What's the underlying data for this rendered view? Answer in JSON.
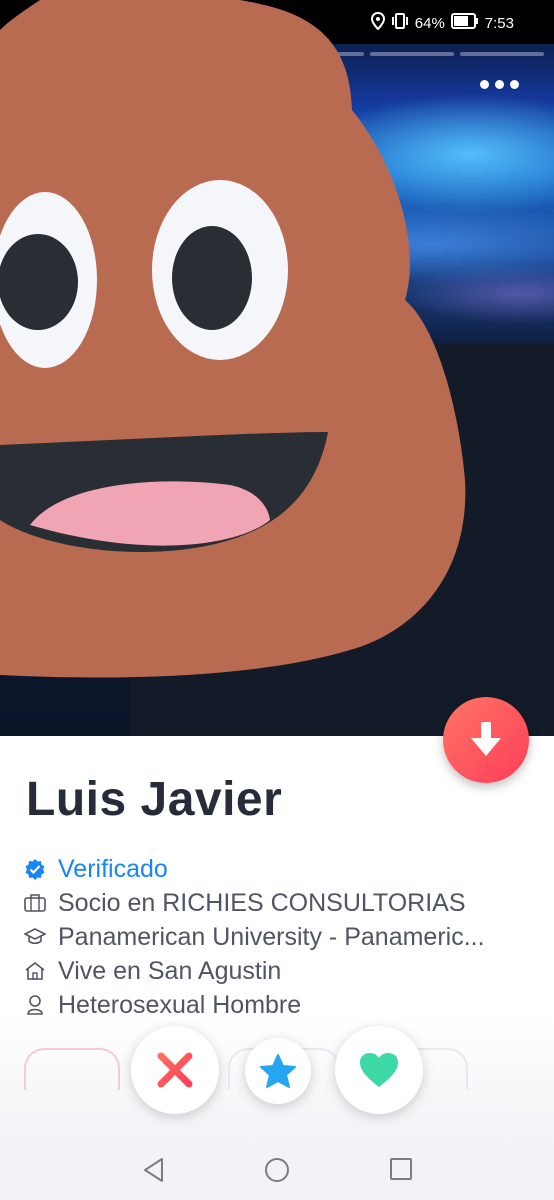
{
  "status_bar": {
    "battery_percent": "64%",
    "time": "7:53",
    "icons": [
      "wifi-icon",
      "location-icon",
      "vibrate-icon",
      "battery-icon"
    ]
  },
  "profile": {
    "name": "Luis Javier",
    "photo_count": 6,
    "active_photo": 2,
    "details": [
      {
        "icon": "verified-badge-icon",
        "text": "Verificado"
      },
      {
        "icon": "briefcase-icon",
        "text": "Socio en RICHIES CONSULTORIAS"
      },
      {
        "icon": "graduation-cap-icon",
        "text": "Panamerican University - Panameric..."
      },
      {
        "icon": "home-icon",
        "text": "Vive en San Agustin"
      },
      {
        "icon": "person-icon",
        "text": "Heterosexual Hombre"
      }
    ]
  },
  "colors": {
    "accent_red": "#fd3d5b",
    "verified_blue": "#1786f8",
    "like_green": "#3cd9a6",
    "star_blue": "#27a6f0",
    "emoji_brown": "#b96b51"
  }
}
